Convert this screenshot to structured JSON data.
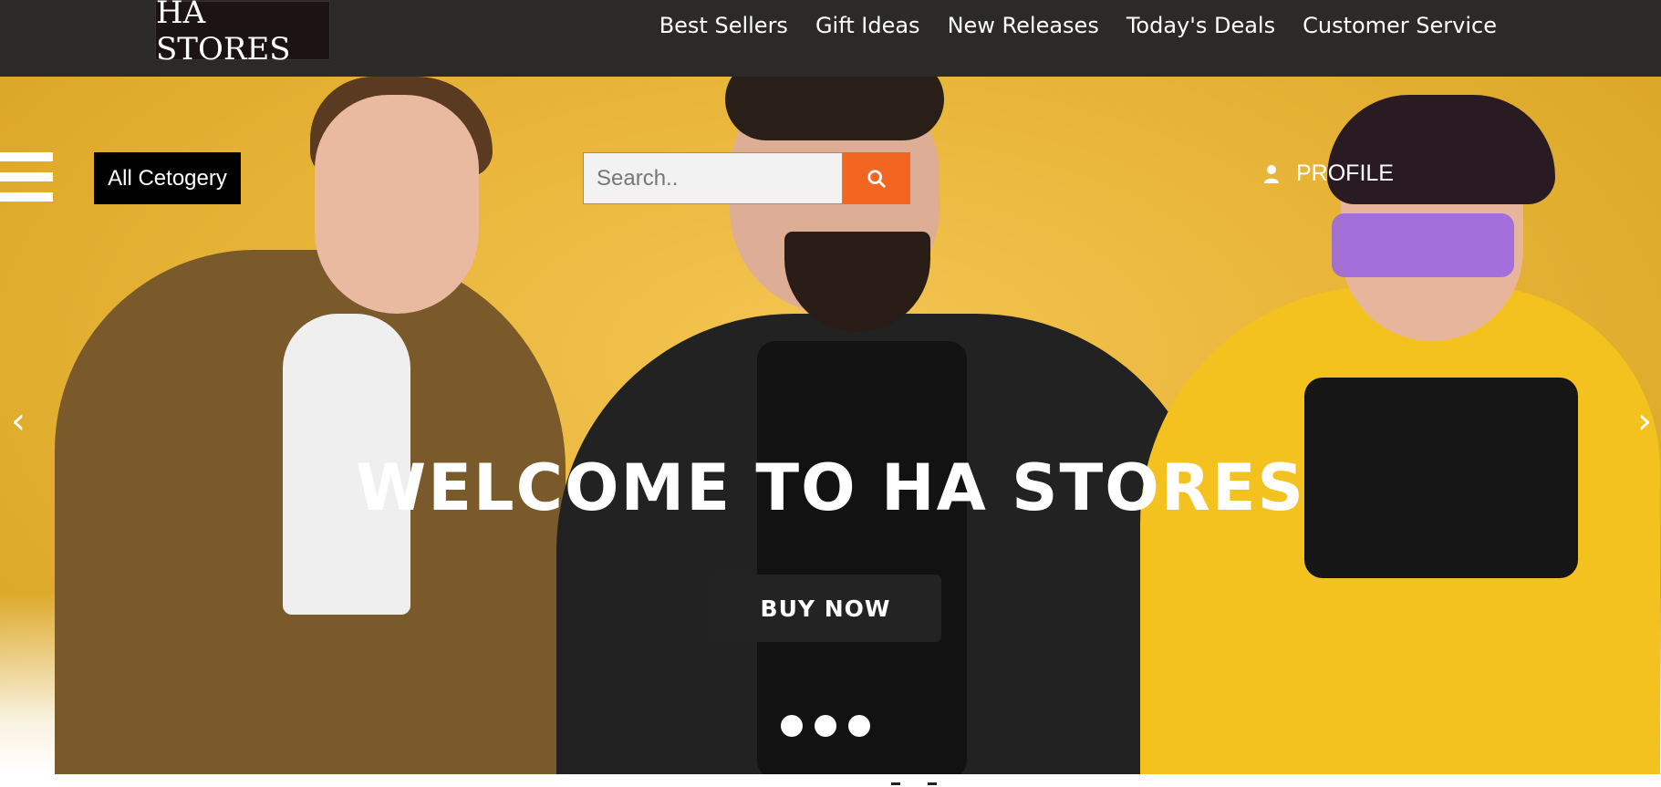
{
  "header": {
    "logo_text": "HA STORES",
    "nav": [
      "Best Sellers",
      "Gift Ideas",
      "New Releases",
      "Today's Deals",
      "Customer Service"
    ]
  },
  "controls": {
    "category_label": "All Cetogery",
    "search_placeholder": "Search..",
    "profile_label": "PROFILE"
  },
  "hero": {
    "headline": "WELCOME TO HA STORES",
    "cta_label": "BUY NOW",
    "prev_symbol": "‹",
    "next_symbol": "›",
    "slides": 3
  },
  "colors": {
    "topbar": "#2b2a29",
    "accent": "#f26622",
    "hero_bg": "#e9b63a"
  },
  "icons": [
    "menu-icon",
    "search-icon",
    "user-icon",
    "chevron-left-icon",
    "chevron-right-icon"
  ]
}
